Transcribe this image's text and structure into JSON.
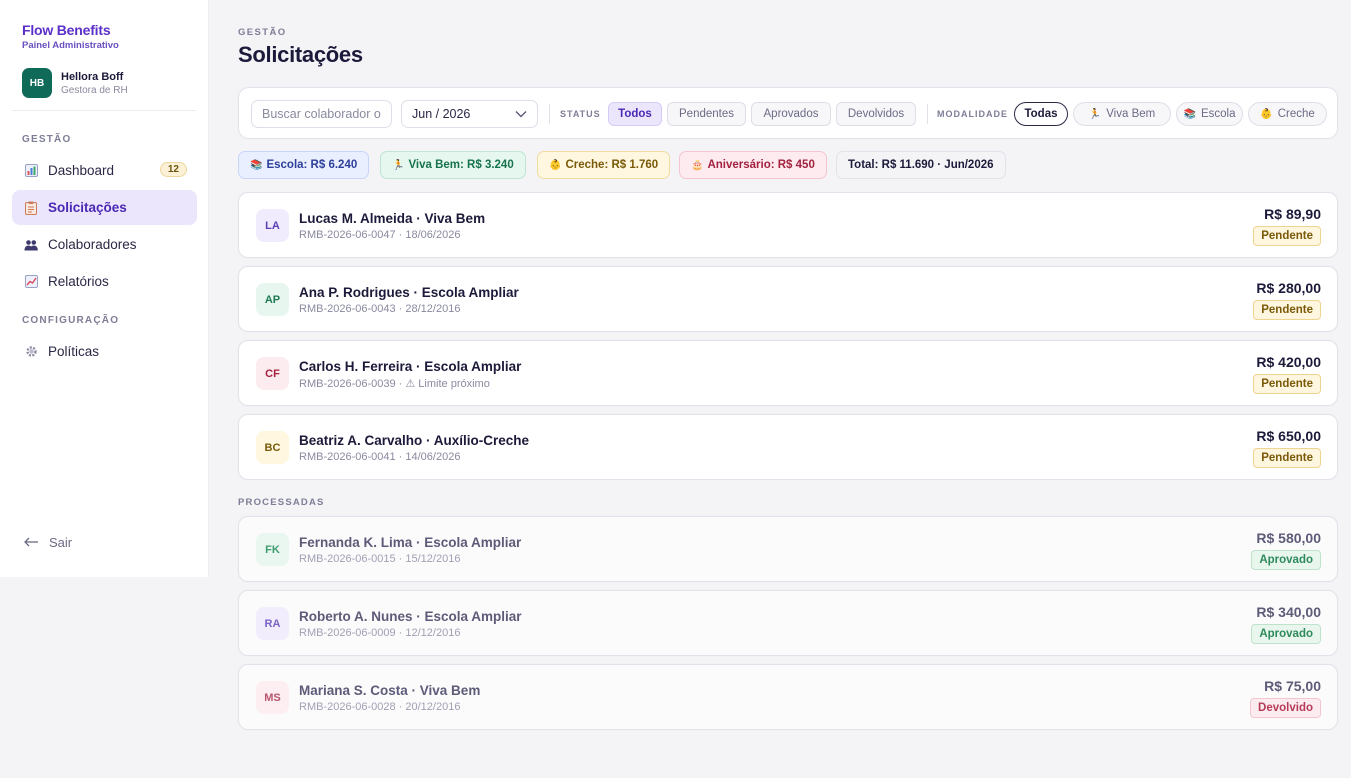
{
  "brand": {
    "name": "Flow Benefits",
    "subtitle": "Painel Administrativo"
  },
  "user": {
    "initials": "HB",
    "name": "Hellora Boff",
    "role": "Gestora de RH"
  },
  "sidebar": {
    "section_gestao": "GESTÃO",
    "section_config": "CONFIGURAÇÃO",
    "items": [
      {
        "label": "Dashboard",
        "icon": "bar-chart-icon",
        "badge": "12"
      },
      {
        "label": "Solicitações",
        "icon": "clipboard-icon"
      },
      {
        "label": "Colaboradores",
        "icon": "people-icon"
      },
      {
        "label": "Relatórios",
        "icon": "trend-chart-icon"
      },
      {
        "label": "Políticas",
        "icon": "gear-icon"
      }
    ],
    "logout": "Sair"
  },
  "header": {
    "breadcrumb": "GESTÃO",
    "title": "Solicitações"
  },
  "filters": {
    "search_placeholder": "Buscar colaborador ou",
    "month": "Jun / 2026",
    "status_label": "STATUS",
    "status_options": [
      "Todos",
      "Pendentes",
      "Aprovados",
      "Devolvidos"
    ],
    "modalidade_label": "MODALIDADE",
    "modalidade_options": [
      "Todas",
      "Viva Bem",
      "Escola",
      "Creche"
    ]
  },
  "summary": {
    "escola": "Escola: R$ 6.240",
    "viva_bem": "Viva Bem: R$ 3.240",
    "creche": "Creche: R$ 1.760",
    "aniversario": "Aniversário: R$ 450",
    "total": "Total: R$ 11.690 · Jun/2026"
  },
  "pending": [
    {
      "initials": "LA",
      "name": "Lucas M. Almeida · Viva Bem",
      "meta": "RMB-2026-06-0047 · 18/06/2026",
      "amount": "R$ 89,90",
      "status": "Pendente"
    },
    {
      "initials": "AP",
      "name": "Ana P. Rodrigues · Escola Ampliar",
      "meta": "RMB-2026-06-0043 · 28/12/2016",
      "amount": "R$ 280,00",
      "status": "Pendente"
    },
    {
      "initials": "CF",
      "name": "Carlos H. Ferreira · Escola Ampliar",
      "meta": "RMB-2026-06-0039 · ⚠ Limite próximo",
      "amount": "R$ 420,00",
      "status": "Pendente"
    },
    {
      "initials": "BC",
      "name": "Beatriz A. Carvalho · Auxílio-Creche",
      "meta": "RMB-2026-06-0041 · 14/06/2026",
      "amount": "R$ 650,00",
      "status": "Pendente"
    }
  ],
  "processed_label": "PROCESSADAS",
  "processed": [
    {
      "initials": "FK",
      "name": "Fernanda K. Lima · Escola Ampliar",
      "meta": "RMB-2026-06-0015 · 15/12/2016",
      "amount": "R$ 580,00",
      "status": "Aprovado"
    },
    {
      "initials": "RA",
      "name": "Roberto A. Nunes · Escola Ampliar",
      "meta": "RMB-2026-06-0009 · 12/12/2016",
      "amount": "R$ 340,00",
      "status": "Aprovado"
    },
    {
      "initials": "MS",
      "name": "Mariana S. Costa · Viva Bem",
      "meta": "RMB-2026-06-0028 · 20/12/2016",
      "amount": "R$ 75,00",
      "status": "Devolvido"
    }
  ],
  "colors": {
    "brand": "#5b2fc9",
    "active_bg": "#ece6fc",
    "avatar": "#0f6b57"
  }
}
